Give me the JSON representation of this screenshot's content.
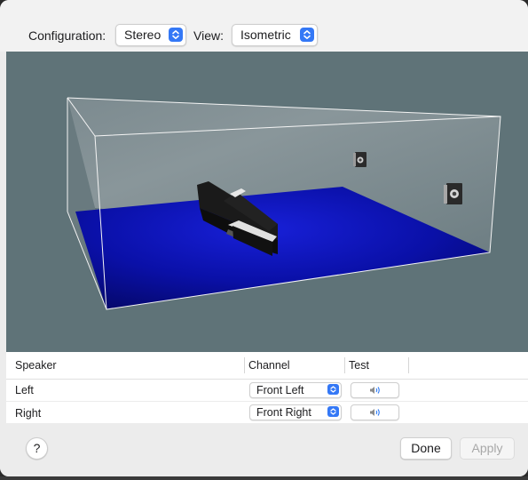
{
  "toolbar": {
    "configuration_label": "Configuration:",
    "configuration_value": "Stereo",
    "view_label": "View:",
    "view_value": "Isometric"
  },
  "scene": {
    "room": "3D room preview",
    "floor_color": "#0a10a8",
    "background_color": "#5f7378",
    "objects": [
      "sofa",
      "left-speaker",
      "right-speaker"
    ]
  },
  "table": {
    "columns": [
      "Speaker",
      "Channel",
      "Test"
    ],
    "rows": [
      {
        "speaker": "Left",
        "channel": "Front Left"
      },
      {
        "speaker": "Right",
        "channel": "Front Right"
      }
    ]
  },
  "footer": {
    "help_label": "?",
    "done_label": "Done",
    "apply_label": "Apply"
  },
  "colors": {
    "accent": "#3478f6"
  },
  "icons": {
    "stepper": "chevron-up-down-icon",
    "test": "speaker-wave-icon",
    "help": "question-mark-icon"
  }
}
